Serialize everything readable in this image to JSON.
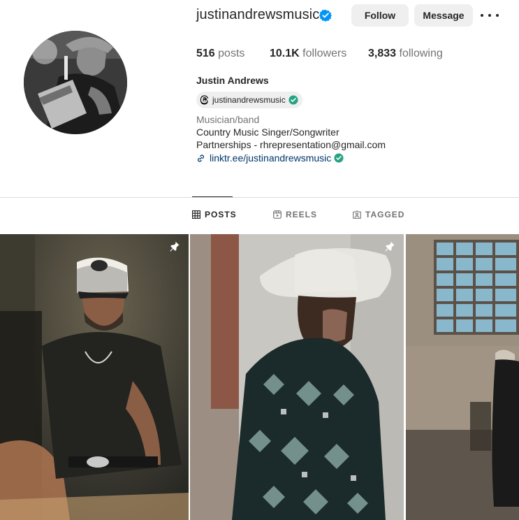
{
  "profile": {
    "username": "justinandrewsmusic",
    "verified": true,
    "full_name": "Justin Andrews",
    "threads_handle": "justinandrewsmusic",
    "category": "Musician/band",
    "bio_lines": [
      "Country Music Singer/Songwriter",
      "Partnerships - rhrepresentation@gmail.com"
    ],
    "link": "linktr.ee/justinandrewsmusic"
  },
  "actions": {
    "follow_label": "Follow",
    "message_label": "Message"
  },
  "stats": {
    "posts_count": "516",
    "posts_label": "posts",
    "followers_count": "10.1K",
    "followers_label": "followers",
    "following_count": "3,833",
    "following_label": "following"
  },
  "tabs": [
    {
      "label": "POSTS",
      "icon": "grid-icon",
      "active": true
    },
    {
      "label": "REELS",
      "icon": "reels-icon",
      "active": false
    },
    {
      "label": "TAGGED",
      "icon": "tagged-icon",
      "active": false
    }
  ],
  "posts": [
    {
      "pinned": true
    },
    {
      "pinned": true
    },
    {
      "pinned": false
    }
  ],
  "colors": {
    "verified_blue": "#0095f6",
    "link_blue": "#00376b",
    "threads_check_green": "#25a384",
    "button_bg": "#efefef"
  }
}
